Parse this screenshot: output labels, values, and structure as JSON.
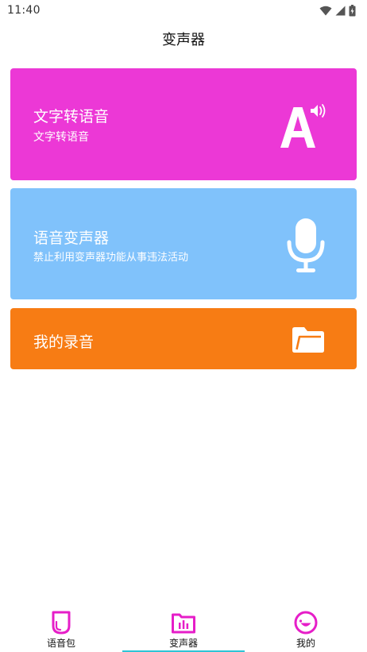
{
  "status_bar": {
    "time": "11:40",
    "icons": [
      "wifi-icon",
      "signal-icon",
      "battery-icon"
    ]
  },
  "header": {
    "title": "变声器"
  },
  "cards": [
    {
      "id": "tts",
      "title": "文字转语音",
      "subtitle": "文字转语音",
      "icon": "text-to-speech-icon",
      "color": "#ec38d6"
    },
    {
      "id": "voice_changer",
      "title": "语音变声器",
      "subtitle": "禁止利用变声器功能从事违法活动",
      "icon": "microphone-icon",
      "color": "#80c2fb"
    },
    {
      "id": "recordings",
      "title": "我的录音",
      "icon": "folder-icon",
      "color": "#f77c14"
    }
  ],
  "bottom_nav": {
    "tabs": [
      {
        "label": "语音包",
        "icon": "voice-pack-icon"
      },
      {
        "label": "变声器",
        "icon": "voice-changer-icon",
        "selected": true
      },
      {
        "label": "我的",
        "icon": "profile-icon"
      }
    ],
    "accent": "#e61ec8",
    "indicator_color": "#2ec4d6"
  }
}
